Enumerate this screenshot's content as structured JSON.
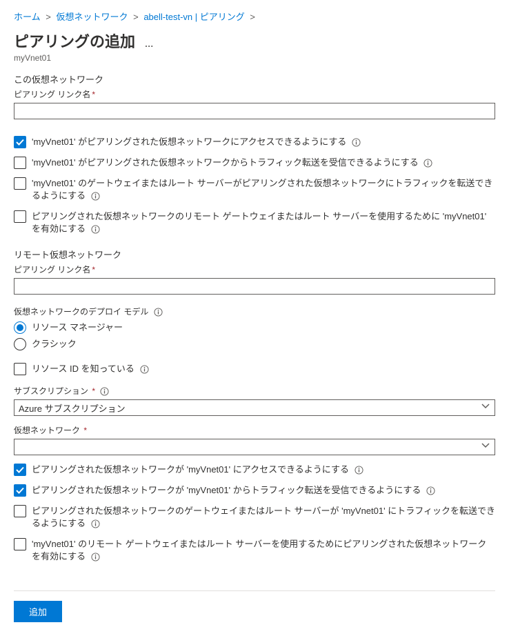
{
  "breadcrumb": {
    "home": "ホーム",
    "vnets": "仮想ネットワーク",
    "vnet_name": "abell-test-vn",
    "peering": "ピアリング"
  },
  "title": "ピアリングの追加",
  "title_dots": "…",
  "subtitle": "myVnet01",
  "this_vnet": {
    "heading": "この仮想ネットワーク",
    "link_name_label": "ピアリング リンク名",
    "link_name_value": "",
    "opt_allow_access": "'myVnet01' がピアリングされた仮想ネットワークにアクセスできるようにする",
    "opt_allow_forwarded": "'myVnet01' がピアリングされた仮想ネットワークからトラフィック転送を受信できるようにする",
    "opt_allow_gateway": "'myVnet01' のゲートウェイまたはルート サーバーがピアリングされた仮想ネットワークにトラフィックを転送できるようにする",
    "opt_use_remote_gw": "ピアリングされた仮想ネットワークのリモート ゲートウェイまたはルート サーバーを使用するために 'myVnet01' を有効にする"
  },
  "remote_vnet": {
    "heading": "リモート仮想ネットワーク",
    "link_name_label": "ピアリング リンク名",
    "link_name_value": "",
    "deploy_model_label": "仮想ネットワークのデプロイ モデル",
    "model_rm": "リソース マネージャー",
    "model_classic": "クラシック",
    "know_resource_id": "リソース ID を知っている",
    "subscription_label": "サブスクリプション",
    "subscription_value": "Azure サブスクリプション",
    "vnet_label": "仮想ネットワーク",
    "vnet_value": "",
    "opt_allow_access": "ピアリングされた仮想ネットワークが 'myVnet01' にアクセスできるようにする",
    "opt_allow_forwarded": "ピアリングされた仮想ネットワークが 'myVnet01' からトラフィック転送を受信できるようにする",
    "opt_allow_gateway": "ピアリングされた仮想ネットワークのゲートウェイまたはルート サーバーが 'myVnet01' にトラフィックを転送できるようにする",
    "opt_use_remote_gw": "'myVnet01' のリモート ゲートウェイまたはルート サーバーを使用するためにピアリングされた仮想ネットワークを有効にする"
  },
  "footer": {
    "add_button": "追加"
  }
}
